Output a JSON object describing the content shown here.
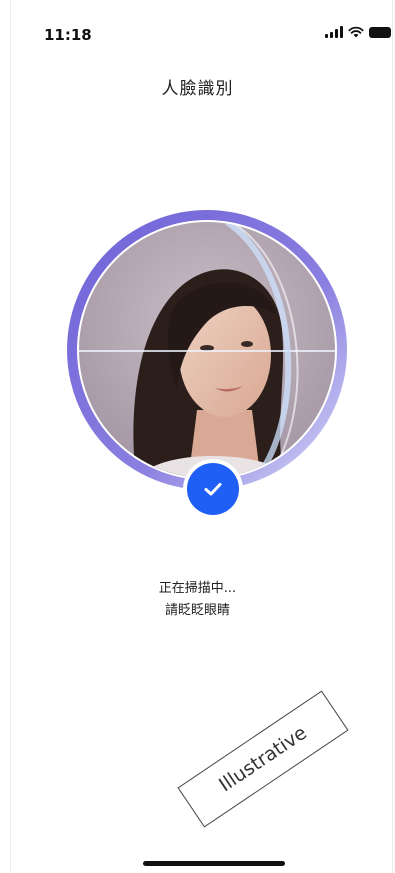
{
  "status_bar": {
    "time": "11:18",
    "icons": [
      "cellular-signal-icon",
      "wifi-icon",
      "battery-icon"
    ]
  },
  "header": {
    "title": "人臉識別"
  },
  "scan": {
    "status_line_1": "正在掃描中...",
    "status_line_2": "請眨眨眼睛",
    "badge_icon": "checkmark-icon"
  },
  "watermark": {
    "text": "Illustrative"
  },
  "colors": {
    "accent": "#1f5ff5",
    "ring_gradient_start": "#6f62d8",
    "ring_gradient_end": "#cfd3f6"
  }
}
